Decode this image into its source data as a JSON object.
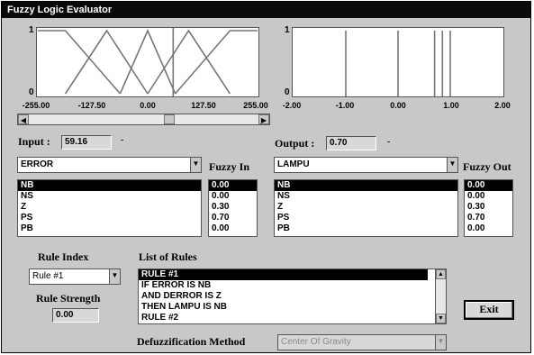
{
  "window": {
    "title": "Fuzzy Logic Evaluator"
  },
  "input_plot": {
    "y_max_label": "1",
    "y_min_label": "0",
    "x_ticks": [
      "-255.00",
      "-127.50",
      "0.00",
      "127.50",
      "255.00"
    ],
    "x_range": [
      -255,
      255
    ],
    "marker": 59.16,
    "sets": [
      {
        "name": "NB",
        "points": [
          [
            -255,
            1
          ],
          [
            -191,
            1
          ],
          [
            -64,
            0
          ]
        ]
      },
      {
        "name": "NS",
        "points": [
          [
            -191,
            0
          ],
          [
            -95,
            1
          ],
          [
            0,
            0
          ]
        ]
      },
      {
        "name": "Z",
        "points": [
          [
            -64,
            0
          ],
          [
            0,
            1
          ],
          [
            64,
            0
          ]
        ]
      },
      {
        "name": "PS",
        "points": [
          [
            0,
            0
          ],
          [
            95,
            1
          ],
          [
            191,
            0
          ]
        ]
      },
      {
        "name": "PB",
        "points": [
          [
            64,
            0
          ],
          [
            191,
            1
          ],
          [
            255,
            1
          ]
        ]
      }
    ]
  },
  "output_plot": {
    "y_max_label": "1",
    "y_min_label": "0",
    "x_ticks": [
      "-2.00",
      "-1.00",
      "0.00",
      "1.00",
      "2.00"
    ],
    "x_range": [
      -2,
      2
    ],
    "singletons": [
      -1.0,
      0.0,
      0.7,
      0.85,
      1.0
    ]
  },
  "input": {
    "label": "Input :",
    "value": "59.16",
    "suffix": "-"
  },
  "output": {
    "label": "Output :",
    "value": "0.70",
    "suffix": "-"
  },
  "input_var": {
    "selected": "ERROR"
  },
  "output_var": {
    "selected": "LAMPU"
  },
  "fuzzy_in": {
    "label": "Fuzzy In"
  },
  "fuzzy_out": {
    "label": "Fuzzy Out"
  },
  "input_sets": [
    "NB",
    "NS",
    "Z",
    "PS",
    "PB"
  ],
  "input_values": [
    "0.00",
    "0.00",
    "0.30",
    "0.70",
    "0.00"
  ],
  "output_sets": [
    "NB",
    "NS",
    "Z",
    "PS",
    "PB"
  ],
  "output_values": [
    "0.00",
    "0.00",
    "0.30",
    "0.70",
    "0.00"
  ],
  "rule_index": {
    "label": "Rule Index",
    "selected": "Rule #1"
  },
  "rule_strength": {
    "label": "Rule Strength",
    "value": "0.00"
  },
  "rules": {
    "label": "List of Rules",
    "lines": [
      "RULE #1",
      "IF ERROR IS NB",
      "AND DERROR IS Z",
      "THEN LAMPU IS NB",
      "RULE #2"
    ]
  },
  "exit_button": {
    "label": "Exit"
  },
  "defuzz": {
    "label": "Defuzzification Method",
    "selected": "Center Of Gravity"
  },
  "colors": {
    "curve": "#777777",
    "titlebar": "#0a0a0a",
    "window": "#c8c8c8"
  }
}
